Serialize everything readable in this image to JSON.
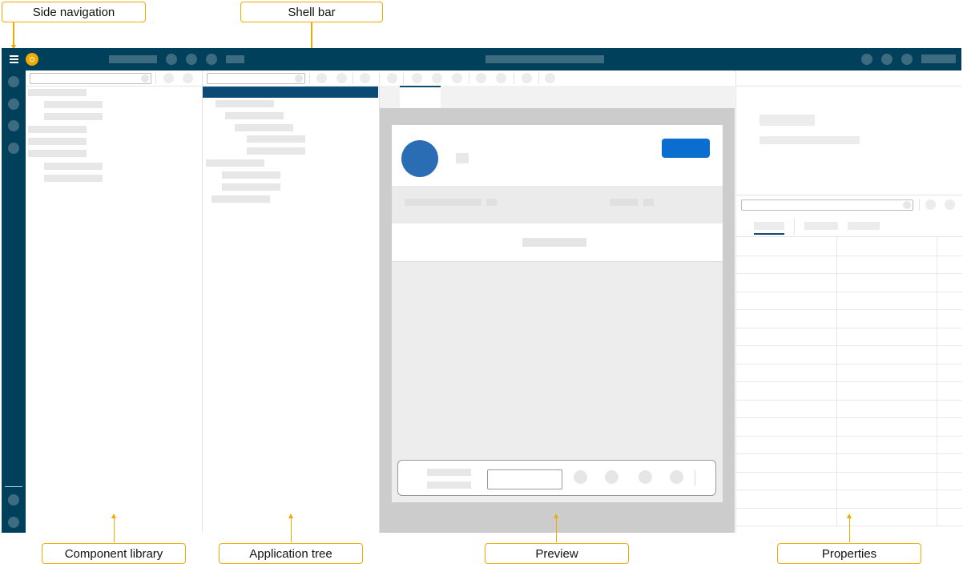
{
  "labels": {
    "side_navigation": "Side navigation",
    "shell_bar": "Shell bar",
    "component_library": "Component library",
    "application_tree": "Application tree",
    "preview": "Preview",
    "properties": "Properties"
  },
  "colors": {
    "shell": "#00405a",
    "callout_border": "#f0ab00",
    "logo": "#f0ab00",
    "selected_row": "#0b4a74",
    "avatar": "#2a6db5",
    "primary_button": "#0a6ed1",
    "preview_canvas": "#cccccc"
  },
  "icons": {
    "menu": "hamburger-menu-icon",
    "logo": "product-logo-icon"
  }
}
